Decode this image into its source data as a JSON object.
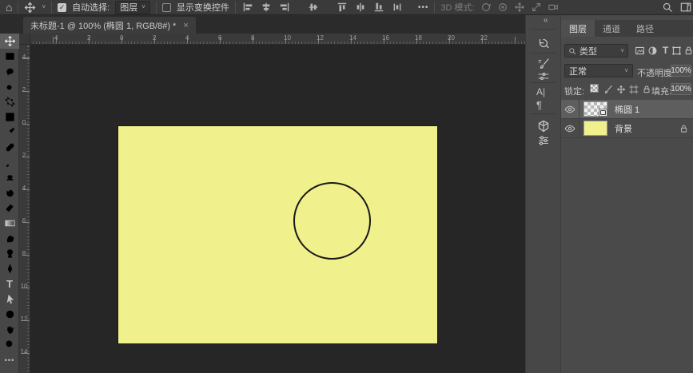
{
  "options_bar": {
    "home_icon": "⌂",
    "auto_select": {
      "checked": true,
      "label": "自动选择:",
      "mode": "图层"
    },
    "show_transform": {
      "checked": false,
      "label": "显示变换控件"
    },
    "more_options": "•••",
    "mode_3d_label": "3D 模式:"
  },
  "document_tab": {
    "title": "未标题-1 @ 100% (椭圆 1, RGB/8#) *",
    "close": "×"
  },
  "rulers": {
    "top": [
      "4",
      "2",
      "0",
      "2",
      "4",
      "6",
      "8",
      "10",
      "12",
      "14",
      "16",
      "18",
      "20",
      "22"
    ],
    "left": [
      "4",
      "2",
      "0",
      "2",
      "4",
      "6",
      "8",
      "10",
      "12",
      "14"
    ]
  },
  "toolbar_tools": [
    "move",
    "rectangular-marquee",
    "lasso",
    "quick-selection",
    "crop",
    "frame",
    "eyedropper",
    "spot-healing-brush",
    "brush",
    "clone-stamp",
    "history-brush",
    "eraser",
    "gradient",
    "smudge",
    "dodge",
    "pen",
    "horizontal-type",
    "path-selection",
    "ellipse",
    "hand",
    "zoom",
    "edit-toolbar"
  ],
  "selected_tool": "move",
  "panel_strip": {
    "collapse": "«",
    "icons": [
      "history",
      "brush-settings",
      "brushes",
      "character",
      "paragraph",
      "3d",
      "properties"
    ],
    "character_glyph": "A|",
    "paragraph_glyph": "¶"
  },
  "layers_panel": {
    "tabs": [
      {
        "label": "图层",
        "active": true
      },
      {
        "label": "通道",
        "active": false
      },
      {
        "label": "路径",
        "active": false
      }
    ],
    "filter": {
      "search_label": "类型"
    },
    "blend_mode": "正常",
    "opacity": {
      "label": "不透明度:",
      "value": "100%"
    },
    "lock": {
      "label": "锁定:"
    },
    "fill": {
      "label": "填充:",
      "value": "100%"
    },
    "layers": [
      {
        "name": "椭圆 1",
        "visible": true,
        "selected": true,
        "thumbnail": "transparent-checkerboard-with-shape-badge"
      },
      {
        "name": "背景",
        "visible": true,
        "locked": true,
        "thumbnail_color": "#f0f08c"
      }
    ]
  },
  "canvas": {
    "document_color": "#f0f08c",
    "shape": "circle-outline",
    "stroke_color": "#181818",
    "zoom_level": "100%"
  },
  "colors": {
    "workspace_bg": "#272727",
    "panel_bg": "#4a4a4a",
    "bar_bg": "#3a3a3a",
    "accent_yellow": "#f0f08c"
  }
}
